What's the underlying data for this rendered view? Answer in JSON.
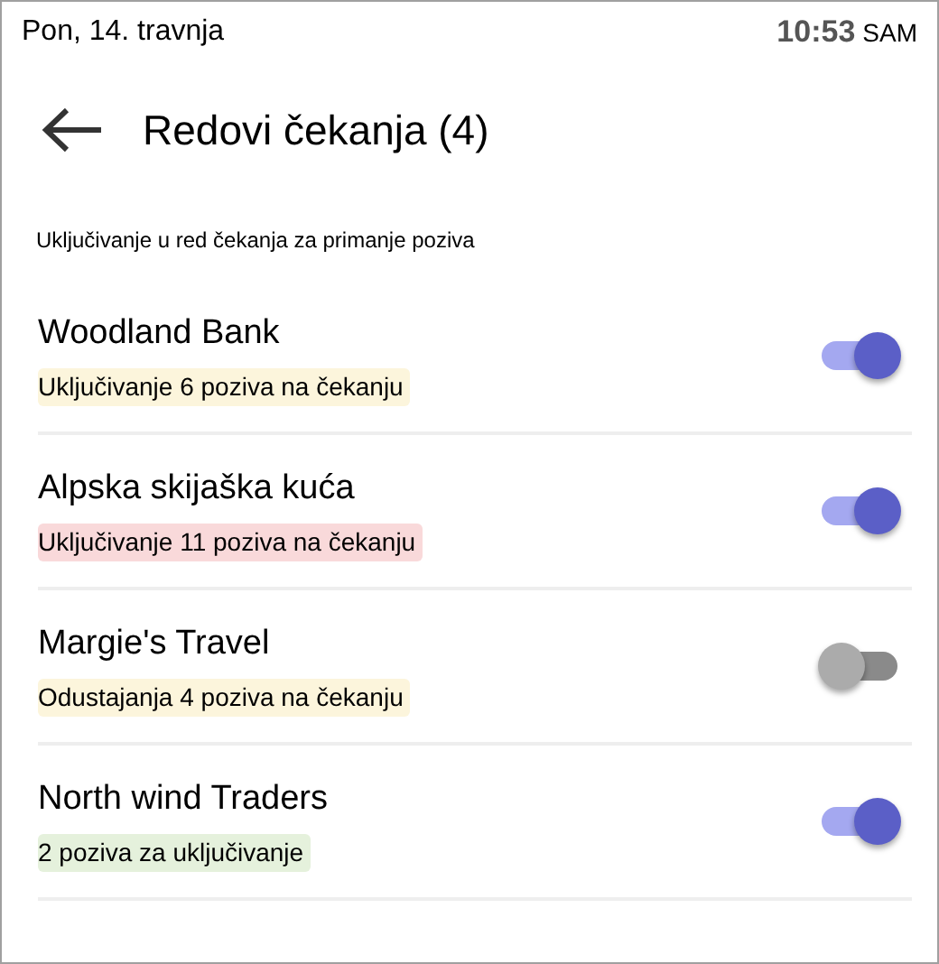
{
  "status_bar": {
    "date": "Pon, 14. travnja",
    "time": "10:53",
    "period": "SAM"
  },
  "header": {
    "title": "Redovi čekanja (4)"
  },
  "section_label": "Uključivanje u red čekanja za primanje poziva",
  "queues": [
    {
      "name": "Woodland Bank",
      "status": "Uključivanje 6 poziva na čekanju",
      "color": "#fcf5dc",
      "on": true
    },
    {
      "name": "Alpska skijaška kuća",
      "status": "Uključivanje 11 poziva na čekanju",
      "color": "#f9d9da",
      "on": true
    },
    {
      "name": "Margie's Travel",
      "status": "Odustajanja 4 poziva na čekanju",
      "color": "#fcf5dc",
      "on": false
    },
    {
      "name": "North wind Traders",
      "status": "2 poziva za uključivanje",
      "color": "#e5f1dc",
      "on": true
    }
  ]
}
